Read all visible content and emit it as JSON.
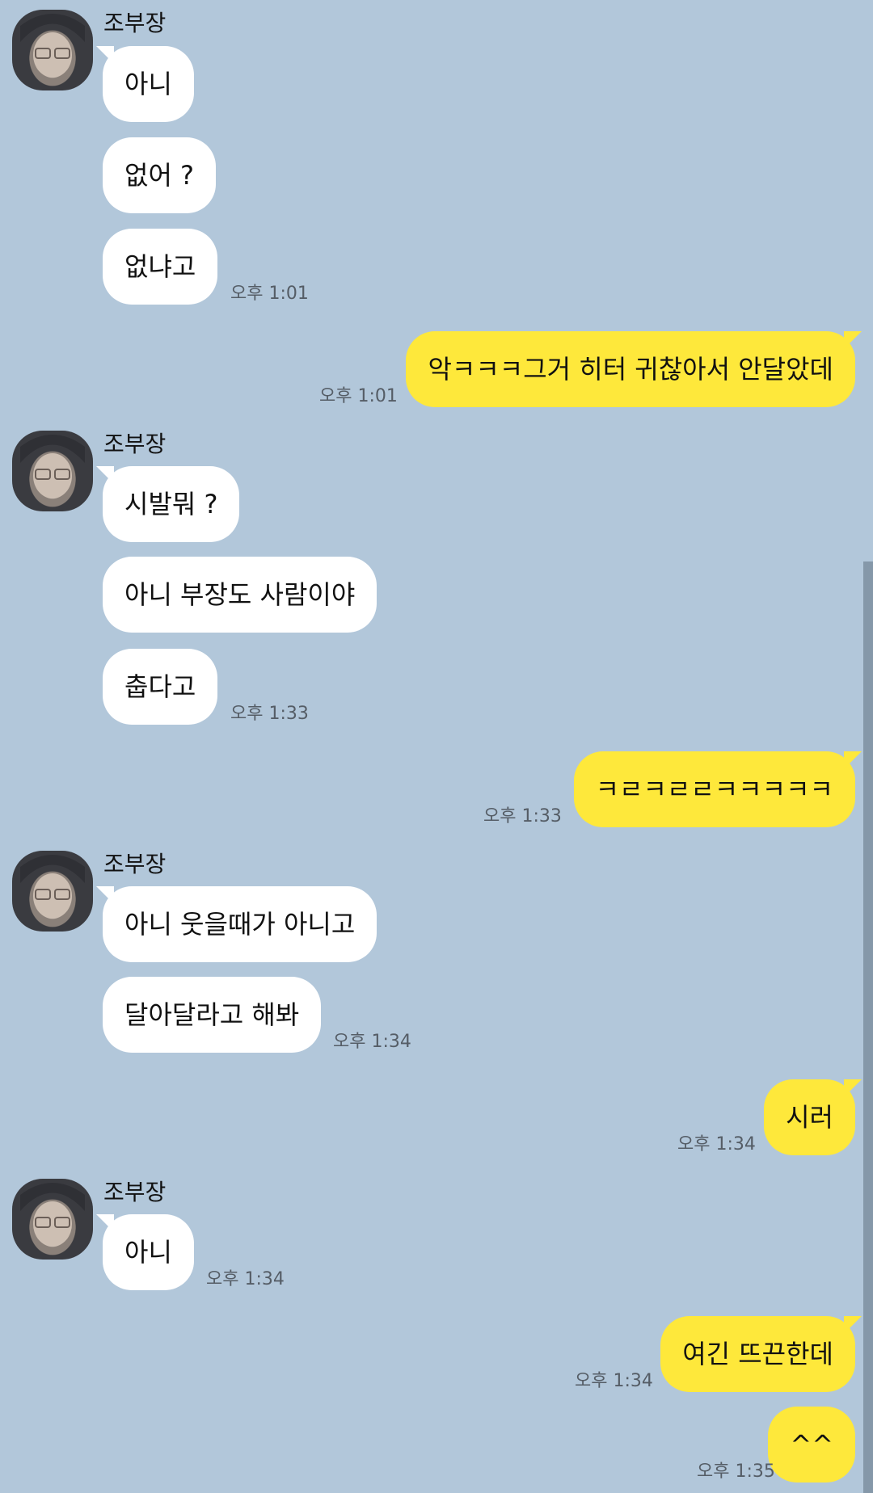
{
  "sender_name": "조부장",
  "colors": {
    "background": "#b2c7da",
    "incoming_bubble": "#ffffff",
    "outgoing_bubble": "#fee83b",
    "timestamp": "#555d66"
  },
  "messages": [
    {
      "dir": "in",
      "text": "아니"
    },
    {
      "dir": "in",
      "text": "없어 ?"
    },
    {
      "dir": "in",
      "text": "없냐고",
      "time": "오후 1:01"
    },
    {
      "dir": "out",
      "text": "악ㅋㅋㅋ그거 히터 귀찮아서 안달았데",
      "time": "오후 1:01"
    },
    {
      "dir": "in",
      "text": "시발뭐 ?"
    },
    {
      "dir": "in",
      "text": "아니 부장도 사람이야"
    },
    {
      "dir": "in",
      "text": "춥다고",
      "time": "오후 1:33"
    },
    {
      "dir": "out",
      "text": "ㅋㄹㅋㄹㄹㅋㅋㅋㅋㅋ",
      "time": "오후 1:33"
    },
    {
      "dir": "in",
      "text": "아니 웃을때가 아니고"
    },
    {
      "dir": "in",
      "text": "달아달라고 해봐",
      "time": "오후 1:34"
    },
    {
      "dir": "out",
      "text": "시러",
      "time": "오후 1:34"
    },
    {
      "dir": "in",
      "text": "아니",
      "time": "오후 1:34"
    },
    {
      "dir": "out",
      "text": "여긴 뜨끈한데",
      "time": "오후 1:34"
    },
    {
      "dir": "out",
      "text": "^^",
      "time": "오후 1:35"
    }
  ]
}
